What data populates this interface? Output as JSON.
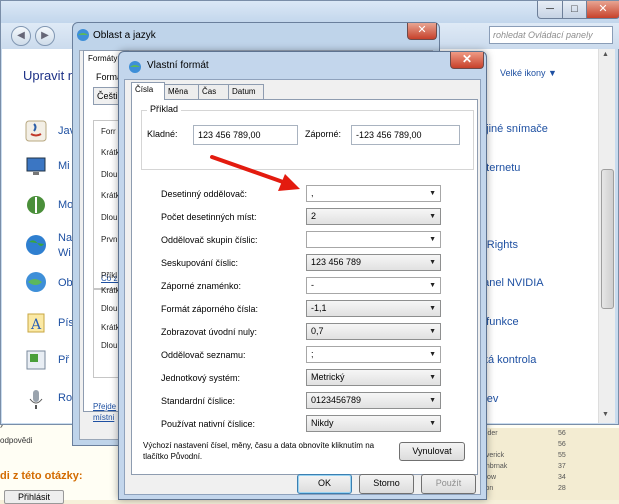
{
  "background_page": {
    "bottom_text_lines": [
      "ý",
      "odpovědi"
    ],
    "question_heading": "di z této otázky:",
    "reply_button": "Přihlásit",
    "table_rows": [
      {
        "name": "leder",
        "value": "56"
      },
      {
        "name": "",
        "value": "56"
      },
      {
        "name": "averick",
        "value": "55"
      },
      {
        "name": "onbrnak",
        "value": "37"
      },
      {
        "name": "slow",
        "value": "34"
      },
      {
        "name": "kon",
        "value": "28"
      }
    ]
  },
  "control_panel": {
    "nav_back": "◀",
    "nav_forward": "▶",
    "search_placeholder": "rohledat Ovládací panely",
    "heading": "Upravit n",
    "view_label": "Velké ikony ▼",
    "minimize": "─",
    "maximize": "□",
    "close": "✕",
    "left_items": [
      "Jav",
      "Mi",
      "Mo",
      "Na",
      "Wi",
      "Ob",
      "Pís",
      "Př",
      "Ro"
    ],
    "right_items": [
      "a jiné snímače",
      "Internetu",
      "rnRights",
      "panel NVIDIA",
      "a funkce",
      "ská kontrola",
      "arev"
    ]
  },
  "region_window": {
    "title": "Oblast a jazyk",
    "close": "✕",
    "tab": "Formáty",
    "format_label": "Formá",
    "format_value": "Češti",
    "labels_group1": [
      "Forr",
      "Krátk",
      "Dlou",
      "Krátk",
      "Dlou",
      "Prvn"
    ],
    "link1": "Co zi",
    "labels_group2": [
      "Příkl",
      "Krátk",
      "Dlou",
      "Krátk",
      "Dlou"
    ],
    "link2_line1": "Přejde",
    "link2_line2": "místni"
  },
  "custom_format": {
    "title": "Vlastní formát",
    "close": "✕",
    "tabs": [
      "Čísla",
      "Měna",
      "Čas",
      "Datum"
    ],
    "active_tab": "Čísla",
    "sample": {
      "legend": "Příklad",
      "positive_label": "Kladné:",
      "positive_value": "123 456 789,00",
      "negative_label": "Záporné:",
      "negative_value": "-123 456 789,00"
    },
    "settings": [
      {
        "label": "Desetinný oddělovač:",
        "value": ","
      },
      {
        "label": "Počet desetinných míst:",
        "value": "2"
      },
      {
        "label": "Oddělovač skupin číslic:",
        "value": " "
      },
      {
        "label": "Seskupování číslic:",
        "value": "123 456 789"
      },
      {
        "label": "Záporné znaménko:",
        "value": "-"
      },
      {
        "label": "Formát záporného čísla:",
        "value": "-1,1"
      },
      {
        "label": "Zobrazovat úvodní nuly:",
        "value": "0,7"
      },
      {
        "label": "Oddělovač seznamu:",
        "value": ";"
      },
      {
        "label": "Jednotkový systém:",
        "value": "Metrický"
      },
      {
        "label": "Standardní číslice:",
        "value": "0123456789"
      },
      {
        "label": "Používat nativní číslice:",
        "value": "Nikdy"
      }
    ],
    "dropdown_arrow": "▼",
    "reset_text": "Výchozí nastavení čísel, měny, času a data obnovíte kliknutím na tlačítko Původní.",
    "reset_button": "Vynulovat",
    "ok_button": "OK",
    "cancel_button": "Storno",
    "apply_button": "Použít"
  },
  "colors": {
    "annotation_arrow": "#e31b0f",
    "link_blue": "#1e50a2",
    "window_frame": "#c3d6ec"
  }
}
